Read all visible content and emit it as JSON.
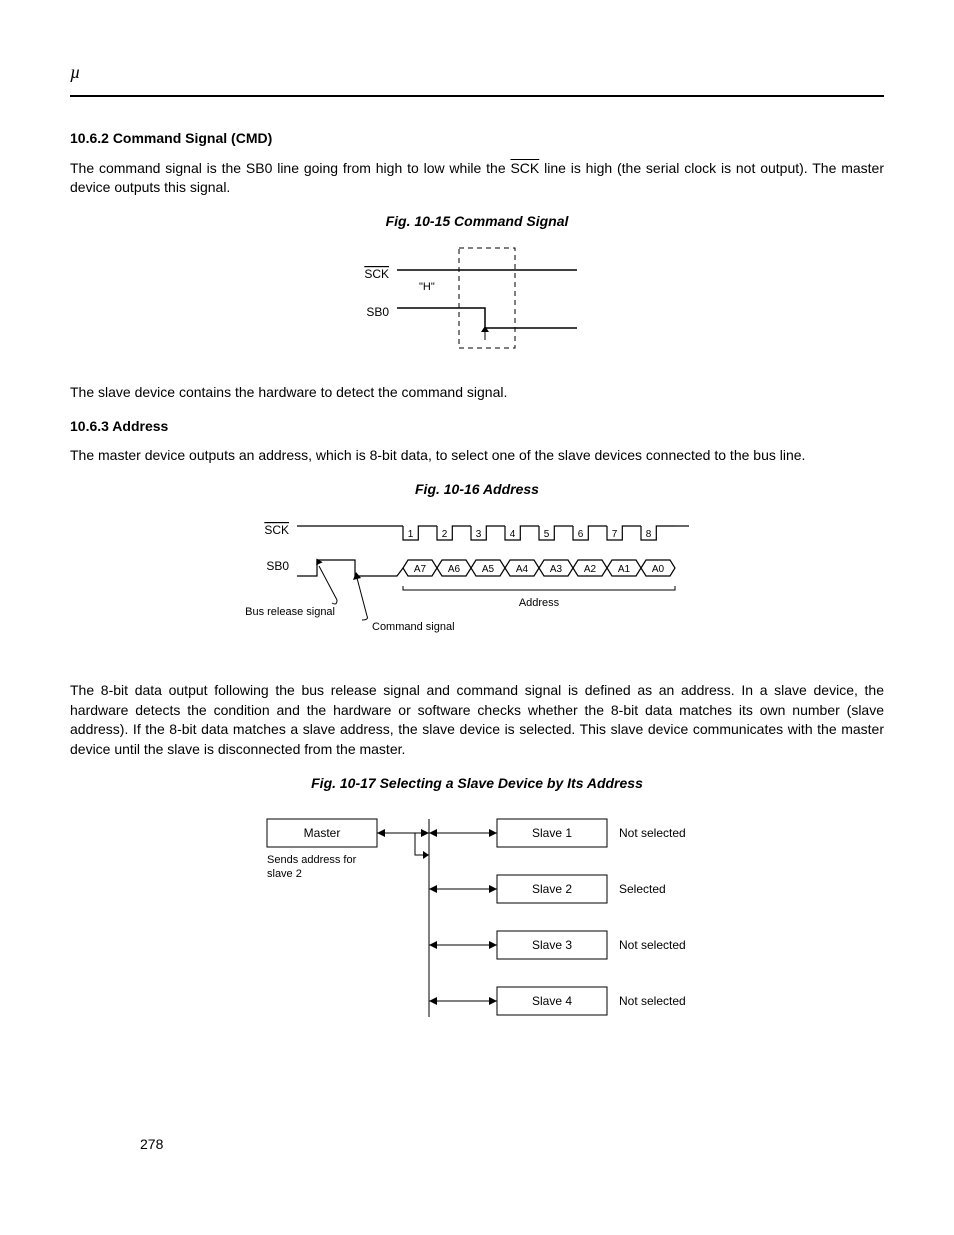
{
  "header": {
    "mu": "µ"
  },
  "section1": {
    "heading": "10.6.2  Command Signal (CMD)",
    "para1_a": "The command signal is the SB0 line going from high to low while the ",
    "para1_sck": "SCK",
    "para1_b": " line is high (the serial clock is not output). The master device outputs this signal.",
    "fig_caption": "Fig. 10-15  Command Signal",
    "para2": "The slave device contains the hardware to detect the command signal."
  },
  "fig15": {
    "sck": "SCK",
    "sb0": "SB0",
    "h": "\"H\""
  },
  "section2": {
    "heading": "10.6.3  Address",
    "para1": "The master device outputs an address, which is 8-bit data, to select one of the slave devices connected to the bus line.",
    "fig16_caption": "Fig. 10-16  Address",
    "para2": "The 8-bit data output following the bus release signal and command signal is defined as an address.  In a slave device, the hardware detects the condition and the hardware or software checks whether the 8-bit data matches its own number (slave address).  If the 8-bit data matches a slave address, the slave device is selected.  This slave device communicates with the master device until the slave is disconnected from the master.",
    "fig17_caption": "Fig. 10-17  Selecting a Slave Device by Its Address"
  },
  "fig16": {
    "sck": "SCK",
    "sb0": "SB0",
    "bits": [
      "1",
      "2",
      "3",
      "4",
      "5",
      "6",
      "7",
      "8"
    ],
    "addr": [
      "A7",
      "A6",
      "A5",
      "A4",
      "A3",
      "A2",
      "A1",
      "A0"
    ],
    "bus_release": "Bus release signal",
    "cmd_signal": "Command signal",
    "address": "Address"
  },
  "fig17": {
    "master": "Master",
    "sends": "Sends address for slave 2",
    "slaves": [
      {
        "name": "Slave 1",
        "status": "Not selected"
      },
      {
        "name": "Slave 2",
        "status": "Selected"
      },
      {
        "name": "Slave 3",
        "status": "Not selected"
      },
      {
        "name": "Slave 4",
        "status": "Not selected"
      }
    ]
  },
  "page_num": "278"
}
